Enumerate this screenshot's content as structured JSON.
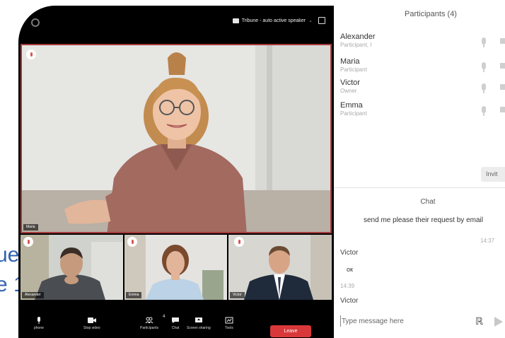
{
  "slide": {
    "line1": "ue",
    "line2": "e 1"
  },
  "video": {
    "layout_label": "Tribune - auto active speaker",
    "main_speaker_name": "Maria",
    "thumbs": [
      {
        "name": "Alexander"
      },
      {
        "name": "Emma"
      },
      {
        "name": "Victor"
      }
    ]
  },
  "toolbar": {
    "microphone_label": "phone",
    "stop_video_label": "Stop video",
    "participants_label": "Participants",
    "participants_count": "4",
    "chat_label": "Chat",
    "screen_sharing_label": "Screen sharing",
    "tools_label": "Tools",
    "leave_label": "Leave"
  },
  "participants": {
    "header": "Participants (4)",
    "items": [
      {
        "name": "Alexander",
        "role": "Participant, I"
      },
      {
        "name": "Maria",
        "role": "Participant"
      },
      {
        "name": "Victor",
        "role": "Owner"
      },
      {
        "name": "Emma",
        "role": "Participant"
      }
    ],
    "invite_label": "Invit"
  },
  "chat": {
    "header": "Chat",
    "messages": [
      {
        "text": "send me please their request by email",
        "time": "14:37"
      },
      {
        "sender": "Victor",
        "text": "ок",
        "time": "14:39"
      }
    ],
    "trailing_sender": "Victor",
    "input_placeholder": "Type message here"
  },
  "colors": {
    "leave": "#d8383a",
    "active_speaker_border": "#a63a3a",
    "slide_text": "#2f62b0"
  }
}
